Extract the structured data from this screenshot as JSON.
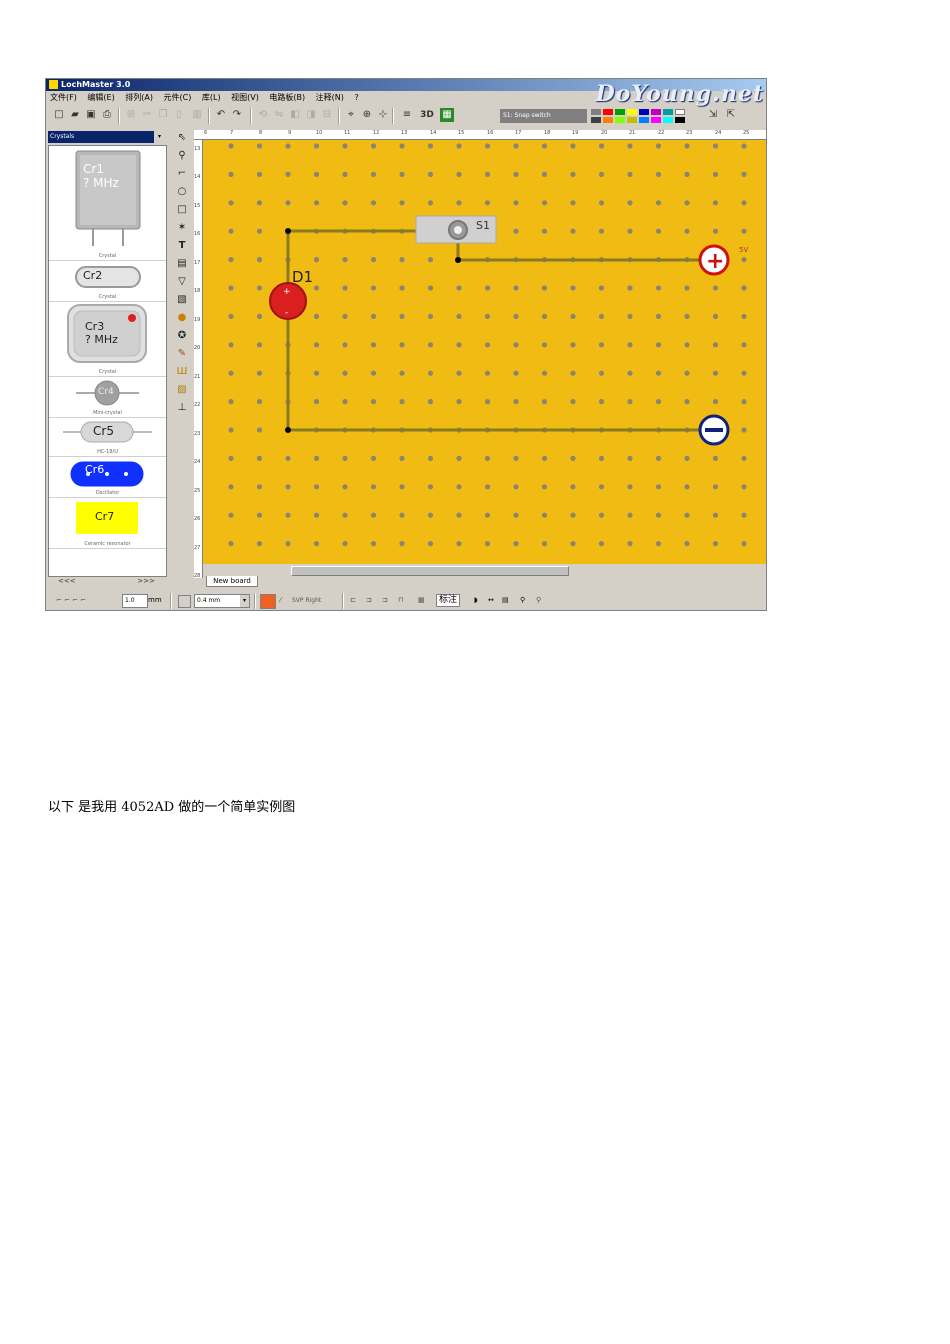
{
  "app": {
    "title": "LochMaster 3.0",
    "brand": "DoYoung.net",
    "menu": [
      "文件(F)",
      "编辑(E)",
      "排列(A)",
      "元件(C)",
      "库(L)",
      "视图(V)",
      "电路板(B)",
      "注释(N)",
      "?"
    ],
    "toolbar_3d_label": "3D",
    "status_text": "S1: Snap switch",
    "library_selected": "Crystals",
    "components": [
      {
        "label": "Cr1",
        "sub": "? MHz",
        "caption": "Crystal"
      },
      {
        "label": "Cr2",
        "caption": "Crystal"
      },
      {
        "label": "Cr3",
        "sub": "? MHz",
        "caption": "Crystal"
      },
      {
        "label": "Cr4",
        "caption": "Mini-crystal"
      },
      {
        "label": "Cr5",
        "caption": "HC-18/U"
      },
      {
        "label": "Cr6",
        "caption": "Oscillator"
      },
      {
        "label": "Cr7",
        "caption": "Ceramic resonator"
      }
    ],
    "nav_prev": "<<<",
    "nav_next": ">>>",
    "ruler_top": [
      "6",
      "7",
      "8",
      "9",
      "10",
      "11",
      "12",
      "13",
      "14",
      "15",
      "16",
      "17",
      "18",
      "19",
      "20",
      "21",
      "22",
      "23",
      "24",
      "25"
    ],
    "ruler_left": [
      "13",
      "14",
      "15",
      "16",
      "17",
      "18",
      "19",
      "20",
      "21",
      "22",
      "23",
      "24",
      "25",
      "26",
      "27",
      "28"
    ],
    "board": {
      "switch_label": "S1",
      "led_label": "D1",
      "plus_terminal_label": "5V"
    },
    "tab_label": "New board",
    "bottom": {
      "width_value": "1.0",
      "width_unit": "mm",
      "track_value": "0.4 mm",
      "dim_label": "SVP  Right",
      "annot_label": "标注"
    },
    "colors": {
      "board": "#f0bc14",
      "track": "#8a7a20",
      "led": "#d91f1f",
      "title_bar": "#0a246a"
    }
  },
  "caption": "以下 是我用 4052AD 做的一个简单实例图"
}
